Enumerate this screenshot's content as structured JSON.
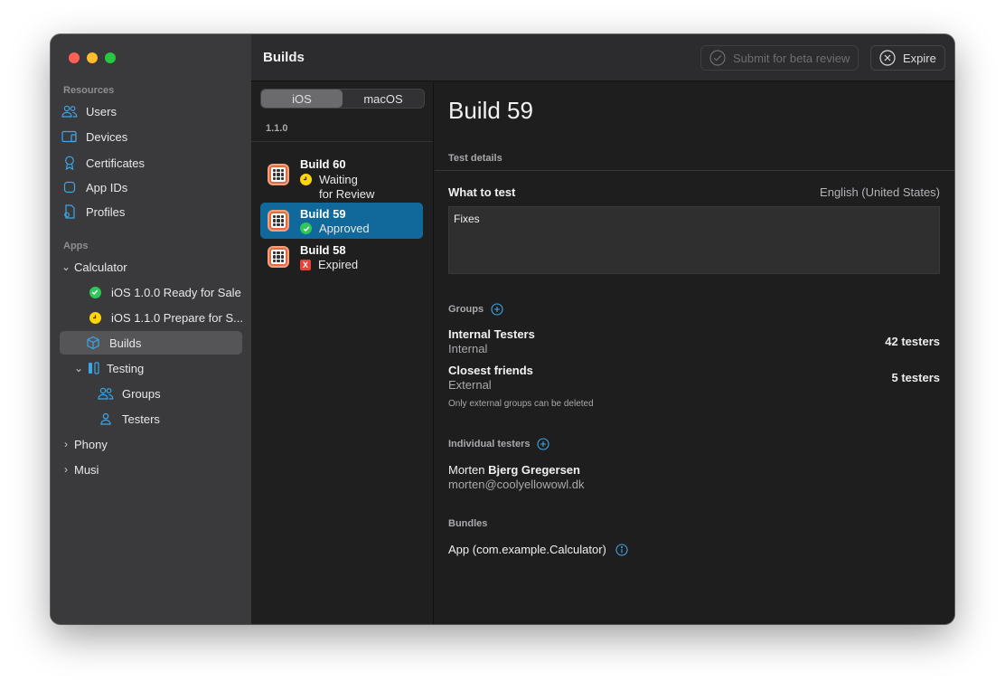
{
  "sidebar": {
    "resources_title": "Resources",
    "resources": [
      {
        "label": "Users",
        "icon": "users-icon"
      },
      {
        "label": "Devices",
        "icon": "devices-icon"
      },
      {
        "label": "Certificates",
        "icon": "certificate-icon"
      },
      {
        "label": "App IDs",
        "icon": "app-id-icon"
      },
      {
        "label": "Profiles",
        "icon": "profile-icon"
      }
    ],
    "apps_title": "Apps",
    "apps": {
      "calculator": "Calculator",
      "ios_100": "iOS 1.0.0 Ready for Sale",
      "ios_110": "iOS 1.1.0 Prepare for S...",
      "builds": "Builds",
      "testing": "Testing",
      "groups": "Groups",
      "testers": "Testers",
      "phony": "Phony",
      "musi": "Musi"
    }
  },
  "toolbar": {
    "title": "Builds",
    "submit_label": "Submit for beta review",
    "expire_label": "Expire"
  },
  "platform": {
    "options": [
      "iOS",
      "macOS"
    ],
    "selected": "iOS"
  },
  "version_label": "1.1.0",
  "builds": [
    {
      "name": "Build 60",
      "status_line1": "Waiting",
      "status_line2": "for Review",
      "status": "waiting"
    },
    {
      "name": "Build 59",
      "status_line1": "Approved",
      "status": "approved"
    },
    {
      "name": "Build 58",
      "status_line1": "Expired",
      "status": "expired"
    }
  ],
  "detail": {
    "title": "Build 59",
    "test_details_label": "Test details",
    "what_to_test_label": "What to test",
    "language": "English (United States)",
    "what_to_test_text": "Fixes",
    "groups_label": "Groups",
    "groups": [
      {
        "name": "Internal Testers",
        "type": "Internal",
        "count": "42 testers"
      },
      {
        "name": "Closest friends",
        "type": "External",
        "count": "5 testers"
      }
    ],
    "groups_note": "Only external groups can be deleted",
    "individual_label": "Individual testers",
    "tester_first": "Morten",
    "tester_last": "Bjerg Gregersen",
    "tester_email": "morten@coolyellowowl.dk",
    "bundles_label": "Bundles",
    "bundle": "App (com.example.Calculator)"
  },
  "colors": {
    "accent": "#11689a",
    "icon_blue": "#3ea6e6",
    "success": "#30c759",
    "warning": "#ffd60a",
    "error": "#e5433b"
  }
}
